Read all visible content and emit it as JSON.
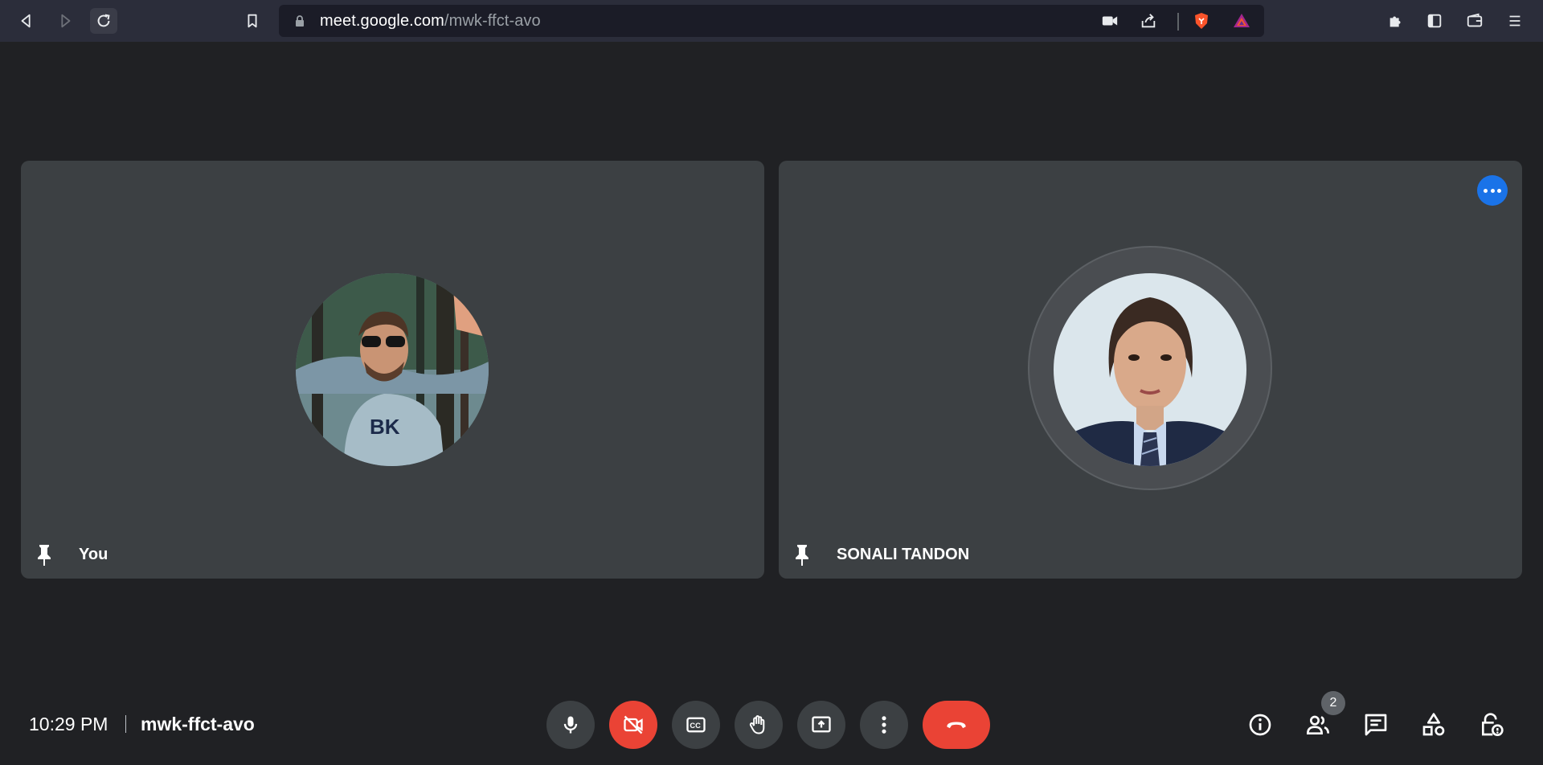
{
  "browser": {
    "url_host": "meet.google.com",
    "url_path": "/mwk-ffct-avo"
  },
  "tiles": [
    {
      "name": "You"
    },
    {
      "name": "SONALI TANDON"
    }
  ],
  "meeting": {
    "time": "10:29 PM",
    "code": "mwk-ffct-avo",
    "participant_count": "2"
  },
  "colors": {
    "background": "#202124",
    "tile": "#3c4043",
    "danger": "#ea4335",
    "accent": "#1a73e8"
  },
  "icons": {
    "controls": [
      "mic-icon",
      "camera-off-icon",
      "captions-icon",
      "raise-hand-icon",
      "present-icon",
      "more-options-icon",
      "hangup-icon"
    ],
    "side": [
      "info-icon",
      "people-icon",
      "chat-icon",
      "activities-icon",
      "host-controls-icon"
    ]
  }
}
